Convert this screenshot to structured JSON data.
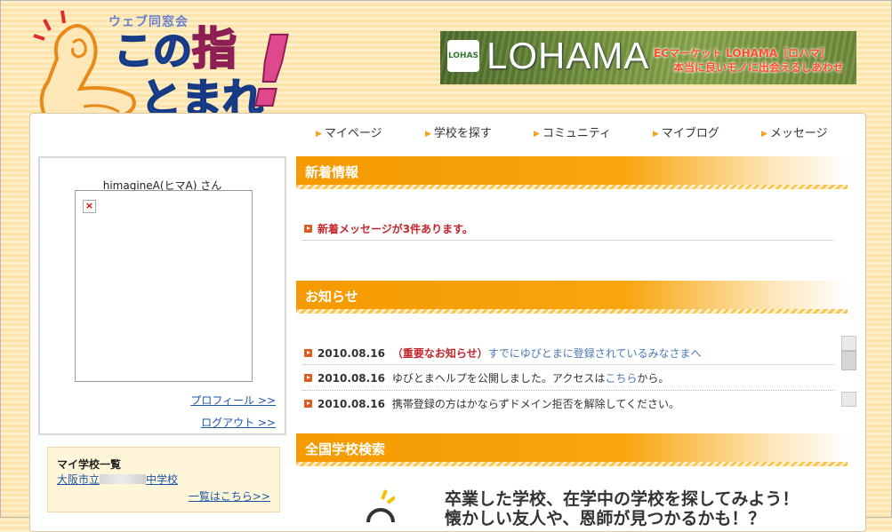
{
  "logo": {
    "catch": "ウェブ同窓会",
    "line1_a": "この",
    "line1_b": "指",
    "line2": "とまれ",
    "excl": "!"
  },
  "banner": {
    "badge": "LOHAS",
    "brand": "LOHAMA",
    "tagline1": "ECマーケット LOHAMA［ロハマ］",
    "tagline2": "本当に良いモノに出会えるしあわせ"
  },
  "nav": {
    "items": [
      "マイページ",
      "学校を探す",
      "コミュニティ",
      "マイブログ",
      "メッセージ"
    ]
  },
  "profile": {
    "username": "himagineA(ヒマA) さん",
    "profile_link": "プロフィール >>",
    "logout_link": "ログアウト >>"
  },
  "myschool": {
    "heading": "マイ学校一覧",
    "school_prefix": "大阪市立",
    "school_suffix": "中学校",
    "more_link": "一覧はこちら>>"
  },
  "whats_new": {
    "title": "新着情報",
    "message": "新着メッセージが3件あります。"
  },
  "notices": {
    "title": "お知らせ",
    "items": [
      {
        "date": "2010.08.16",
        "important": "（重要なお知らせ）",
        "text": "すでにゆびとまに登録されているみなさまへ"
      },
      {
        "date": "2010.08.16",
        "text_a": "ゆびとまヘルプを公開しました。アクセスは",
        "link": "こちら",
        "text_b": "から。"
      },
      {
        "date": "2010.08.16",
        "text": "携帯登録の方はかならずドメイン拒否を解除してください。"
      }
    ]
  },
  "school_search": {
    "title": "全国学校検索",
    "line1": "卒業した学校、在学中の学校を探してみよう！",
    "line2": "懐かしい友人や、恩師が見つかるかも！？"
  },
  "colors": {
    "accent_orange": "#f59a00",
    "link_blue": "#1b55a8",
    "alert_red": "#c4262b"
  }
}
